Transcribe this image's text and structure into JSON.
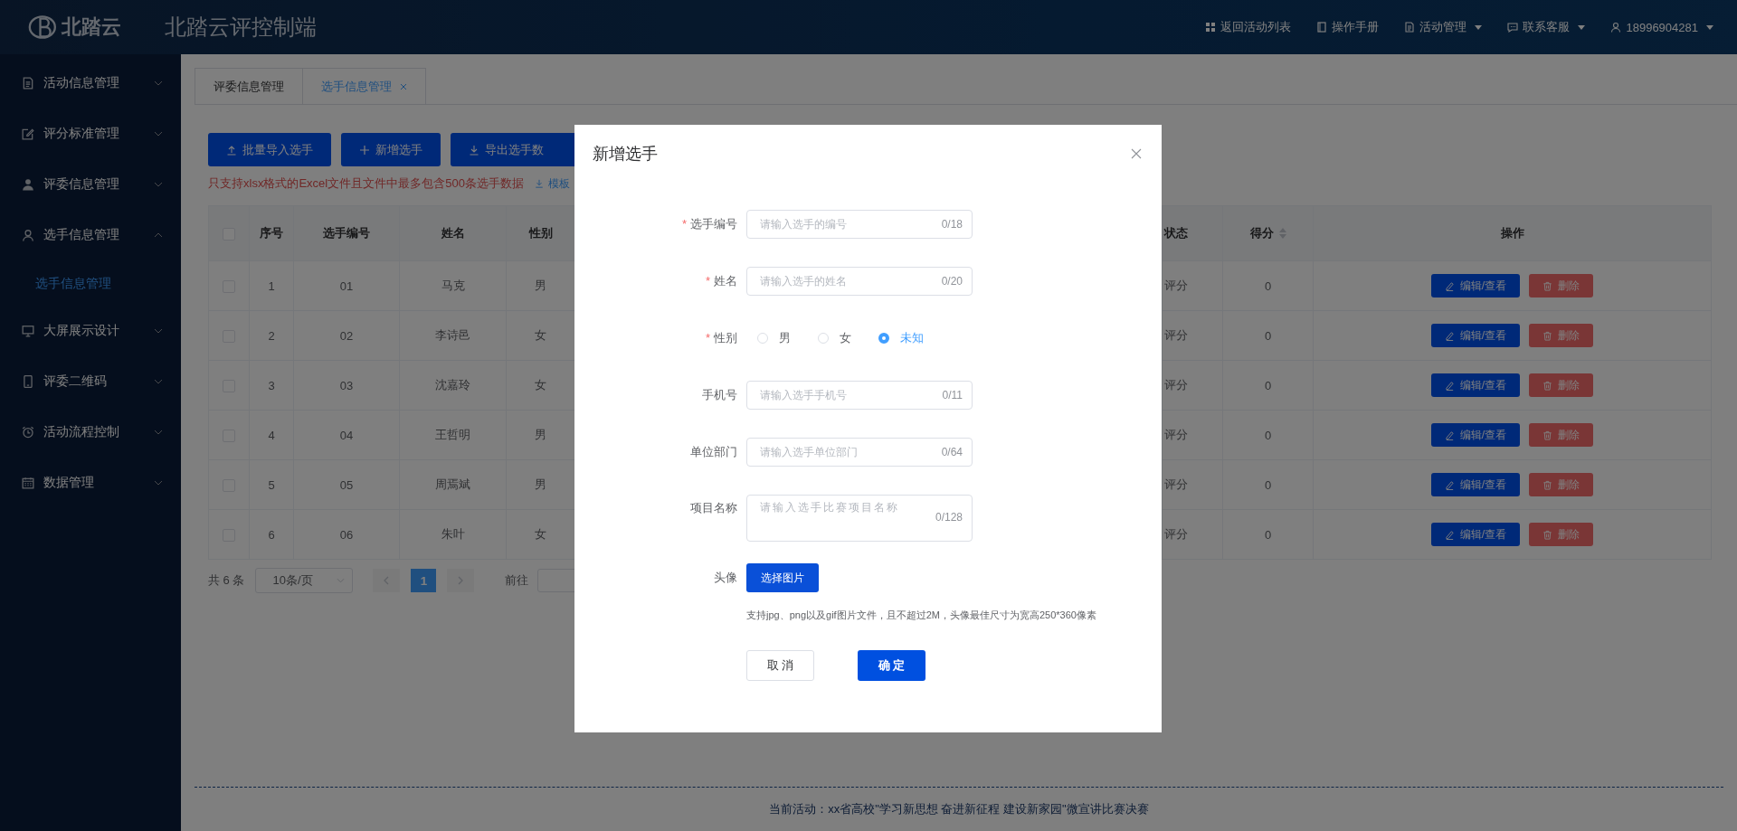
{
  "topbar": {
    "logo": "北踏云",
    "title": "北踏云评控制端",
    "nav": [
      {
        "kind": "grid",
        "label": "返回活动列表",
        "dropdown": false
      },
      {
        "kind": "book",
        "label": "操作手册",
        "dropdown": false
      },
      {
        "kind": "doc",
        "label": "活动管理",
        "dropdown": true
      },
      {
        "kind": "chat",
        "label": "联系客服",
        "dropdown": true
      },
      {
        "kind": "user",
        "label": "18996904281",
        "dropdown": true
      }
    ]
  },
  "sidebar": {
    "items": [
      {
        "kind": "doc",
        "label": "活动信息管理",
        "expanded": false
      },
      {
        "kind": "edit",
        "label": "评分标准管理",
        "expanded": false
      },
      {
        "kind": "person",
        "label": "评委信息管理",
        "expanded": false
      },
      {
        "kind": "user",
        "label": "选手信息管理",
        "expanded": true,
        "children": [
          {
            "label": "选手信息管理",
            "selected": true
          }
        ]
      },
      {
        "kind": "monitor",
        "label": "大屏展示设计",
        "expanded": false
      },
      {
        "kind": "phone",
        "label": "评委二维码",
        "expanded": false
      },
      {
        "kind": "alarm",
        "label": "活动流程控制",
        "expanded": false
      },
      {
        "kind": "calendar",
        "label": "数据管理",
        "expanded": false
      }
    ]
  },
  "tabs": [
    {
      "label": "评委信息管理",
      "selected": false,
      "closable": false
    },
    {
      "label": "选手信息管理",
      "selected": true,
      "closable": true
    }
  ],
  "toolbar": {
    "buttons": [
      {
        "kind": "upload",
        "label": "批量导入选手"
      },
      {
        "kind": "plus",
        "label": "新增选手"
      },
      {
        "kind": "download",
        "label": "导出选手数"
      }
    ],
    "note": "只支持xlsx格式的Excel文件且文件中最多包含500条选手数据",
    "template_link": "模板"
  },
  "table": {
    "select_all_checked": false,
    "columns": [
      {
        "label": "序号",
        "sortable": false
      },
      {
        "label": "选手编号",
        "sortable": false
      },
      {
        "label": "姓名",
        "sortable": false
      },
      {
        "label": "性别",
        "sortable": false
      },
      {
        "label": "状态",
        "sortable": false
      },
      {
        "label": "得分",
        "sortable": true
      },
      {
        "label": "操作",
        "sortable": false
      }
    ],
    "rows": [
      {
        "checked": false,
        "cells": [
          "1",
          "01",
          "马克",
          "男",
          "评分",
          "0"
        ],
        "actions": [
          {
            "kind": "edit",
            "label": "编辑/查看"
          },
          {
            "kind": "delete",
            "label": "删除"
          }
        ]
      },
      {
        "checked": false,
        "cells": [
          "2",
          "02",
          "李诗邑",
          "女",
          "评分",
          "0"
        ],
        "actions": [
          {
            "kind": "edit",
            "label": "编辑/查看"
          },
          {
            "kind": "delete",
            "label": "删除"
          }
        ]
      },
      {
        "checked": false,
        "cells": [
          "3",
          "03",
          "沈嘉玲",
          "女",
          "评分",
          "0"
        ],
        "actions": [
          {
            "kind": "edit",
            "label": "编辑/查看"
          },
          {
            "kind": "delete",
            "label": "删除"
          }
        ]
      },
      {
        "checked": false,
        "cells": [
          "4",
          "04",
          "王哲明",
          "男",
          "评分",
          "0"
        ],
        "actions": [
          {
            "kind": "edit",
            "label": "编辑/查看"
          },
          {
            "kind": "delete",
            "label": "删除"
          }
        ]
      },
      {
        "checked": false,
        "cells": [
          "5",
          "05",
          "周焉斌",
          "男",
          "评分",
          "0"
        ],
        "actions": [
          {
            "kind": "edit",
            "label": "编辑/查看"
          },
          {
            "kind": "delete",
            "label": "删除"
          }
        ]
      },
      {
        "checked": false,
        "cells": [
          "6",
          "06",
          "朱叶",
          "女",
          "评分",
          "0"
        ],
        "actions": [
          {
            "kind": "edit",
            "label": "编辑/查看"
          },
          {
            "kind": "delete",
            "label": "删除"
          }
        ]
      }
    ]
  },
  "pagination": {
    "total": "共 6 条",
    "page_size": "10条/页",
    "pages": [
      {
        "label": "1",
        "selected": true
      }
    ],
    "goto_label": "前往"
  },
  "footer": "当前活动：xx省高校\"学习新思想 奋进新征程 建设新家园\"微宣讲比赛决赛",
  "modal": {
    "title": "新增选手",
    "required_mark": "*",
    "fields": [
      {
        "kind": "input",
        "label": "选手编号",
        "required": true,
        "placeholder": "请输入选手的编号",
        "counter": "0/18"
      },
      {
        "kind": "input",
        "label": "姓名",
        "required": true,
        "placeholder": "请输入选手的姓名",
        "counter": "0/20"
      },
      {
        "kind": "radio",
        "label": "性别",
        "required": true,
        "options": [
          {
            "label": "男",
            "selected": false
          },
          {
            "label": "女",
            "selected": false
          },
          {
            "label": "未知",
            "selected": true
          }
        ]
      },
      {
        "kind": "input",
        "label": "手机号",
        "required": false,
        "placeholder": "请输入选手手机号",
        "counter": "0/11"
      },
      {
        "kind": "input",
        "label": "单位部门",
        "required": false,
        "placeholder": "请输入选手单位部门",
        "counter": "0/64"
      },
      {
        "kind": "textarea",
        "label": "项目名称",
        "required": false,
        "placeholder": "请输入选手比赛项目名称",
        "counter": "0/128"
      },
      {
        "kind": "upload",
        "label": "头像",
        "required": false,
        "button": "选择图片",
        "hint": "支持jpg、png以及gif图片文件，且不超过2M，头像最佳尺寸为宽高250*360像素"
      }
    ],
    "buttons": [
      {
        "kind": "cancel",
        "label": "取 消"
      },
      {
        "kind": "primary",
        "label": "确 定"
      }
    ]
  }
}
